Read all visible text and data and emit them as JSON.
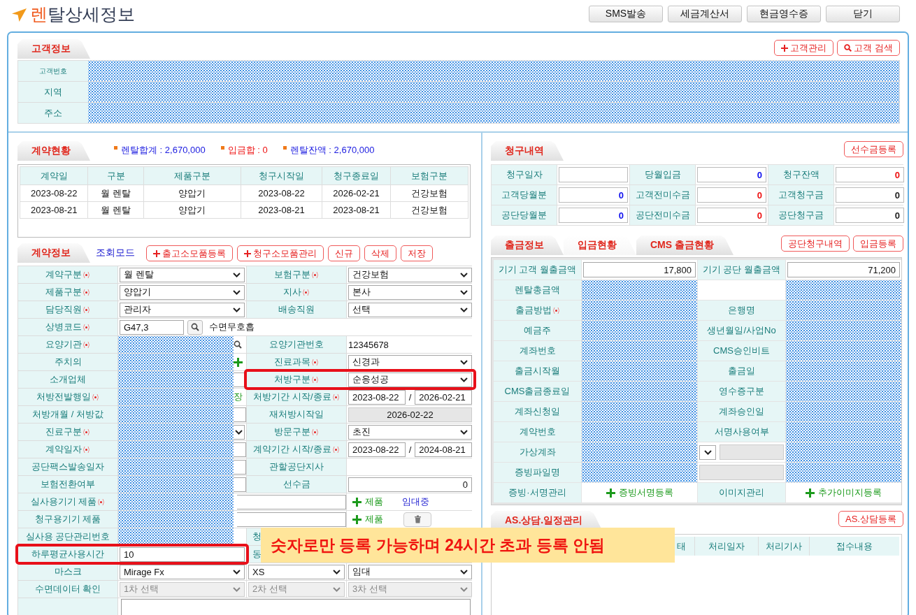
{
  "header": {
    "title_accent": "렌",
    "title": "탈상세정보",
    "buttons": [
      "SMS발송",
      "세금계산서",
      "현금영수증",
      "닫기"
    ]
  },
  "customer": {
    "tab": "고객정보",
    "buttons": [
      {
        "label": "고객관리",
        "kind": "add"
      },
      {
        "label": "고객 검색",
        "kind": "search"
      }
    ],
    "rows": [
      {
        "label": "고객번호",
        "kind": "small"
      },
      {
        "label": "지역",
        "kind": "normal"
      },
      {
        "label": "주소",
        "kind": "normal"
      }
    ]
  },
  "contract_status": {
    "tab": "계약현황",
    "summary": [
      {
        "text": "렌탈합계 : 2,670,000",
        "color": "#1a1ae0"
      },
      {
        "text": "입금합 : 0",
        "color": "#ee1111"
      },
      {
        "text": "렌탈잔액 : 2,670,000",
        "color": "#1a1ae0"
      }
    ],
    "table": {
      "columns": [
        "계약일",
        "구분",
        "제품구분",
        "청구시작일",
        "청구종료일",
        "보험구분"
      ],
      "rows": [
        [
          "2023-08-22",
          "월 렌탈",
          "양압기",
          "2023-08-22",
          "2026-02-21",
          "건강보험"
        ],
        [
          "2023-08-21",
          "월 렌탈",
          "양압기",
          "2023-08-21",
          "2023-08-21",
          "건강보험"
        ]
      ]
    }
  },
  "contract_info": {
    "tab": "계약정보",
    "mode": "조회모드",
    "buttons": [
      {
        "label": "출고소모품등록",
        "kind": "add"
      },
      {
        "label": "청구소모품관리",
        "kind": "add"
      },
      {
        "label": "신규",
        "kind": "plain"
      },
      {
        "label": "삭제",
        "kind": "plain"
      },
      {
        "label": "저장",
        "kind": "plain"
      }
    ],
    "rows": [
      {
        "kind": "pair",
        "label": "계약구분",
        "required": true,
        "value": {
          "kind": "select",
          "text": "월 렌탈"
        },
        "label2": "보험구분",
        "required2": true,
        "value2": {
          "kind": "select",
          "text": "건강보험"
        },
        "highlighted": false,
        "highlighted2": false
      },
      {
        "kind": "pair",
        "label": "제품구분",
        "required": true,
        "value": {
          "kind": "select",
          "text": "양압기"
        },
        "label2": "지사",
        "required2": true,
        "value2": {
          "kind": "select",
          "text": "본사"
        },
        "highlighted": false,
        "highlighted2": false
      },
      {
        "kind": "pair",
        "label": "담당직원",
        "required": true,
        "value": {
          "kind": "select",
          "text": "관리자"
        },
        "label2": "배송직원",
        "required2": false,
        "value2": {
          "kind": "select",
          "text": "선택"
        },
        "highlighted": false,
        "highlighted2": false
      },
      {
        "kind": "code",
        "label": "상병코드",
        "required": true,
        "value": {
          "kind": "input",
          "text": "G47,3"
        },
        "note": "수면무호흡",
        "highlighted": false
      },
      {
        "kind": "pair",
        "label": "요양기관",
        "required": true,
        "value": {
          "kind": "masked",
          "tail": {
            "kind": "search"
          }
        },
        "label2": "요양기관번호",
        "required2": false,
        "value2": {
          "kind": "text",
          "text": "12345678"
        },
        "highlighted": false,
        "highlighted2": false
      },
      {
        "kind": "pair",
        "label": "주치의",
        "required": false,
        "value": {
          "kind": "masked",
          "tail": {
            "kind": "plus"
          }
        },
        "label2": "진료과목",
        "required2": true,
        "value2": {
          "kind": "select",
          "text": "신경과"
        },
        "highlighted": false,
        "highlighted2": false
      },
      {
        "kind": "pair",
        "label": "소개업체",
        "required": false,
        "value": {
          "kind": "masked",
          "tail": {
            "kind": "edge"
          }
        },
        "label2": "처방구분",
        "required2": true,
        "value2": {
          "kind": "select",
          "text": "순응성공"
        },
        "highlighted": false,
        "highlighted2": true
      },
      {
        "kind": "pair",
        "label": "처방전발행일",
        "required": true,
        "value": {
          "kind": "masked",
          "tail": {
            "kind": "text",
            "text": "장"
          }
        },
        "label2": "처방기간 시작/종료",
        "required2": true,
        "value2": {
          "kind": "dates",
          "from": "2023-08-22",
          "sep": "/",
          "to": "2026-02-21"
        },
        "highlighted": false,
        "highlighted2": false
      },
      {
        "kind": "pair",
        "label": "처방개월 / 처방값",
        "required": false,
        "value": {
          "kind": "masked",
          "tail": {
            "kind": "edge"
          }
        },
        "label2": "재처방시작일",
        "required2": false,
        "value2": {
          "kind": "readonly",
          "text": "2026-02-22"
        },
        "highlighted": false,
        "highlighted2": false
      },
      {
        "kind": "pair",
        "label": "진료구분",
        "required": true,
        "value": {
          "kind": "masked",
          "tail": {
            "kind": "caret"
          }
        },
        "label2": "방문구분",
        "required2": true,
        "value2": {
          "kind": "select",
          "text": "초진"
        },
        "highlighted": false,
        "highlighted2": false
      },
      {
        "kind": "pair",
        "label": "계약일자",
        "required": true,
        "value": {
          "kind": "masked",
          "tail": {
            "kind": "edge"
          }
        },
        "label2": "계약기간 시작/종료",
        "required2": true,
        "value2": {
          "kind": "dates",
          "from": "2023-08-22",
          "sep": "/",
          "to": "2024-08-21"
        },
        "highlighted": false,
        "highlighted2": false
      },
      {
        "kind": "pair",
        "label": "공단팩스발송일자",
        "required": false,
        "value": {
          "kind": "masked",
          "tail": {
            "kind": "edge"
          }
        },
        "label2": "관할공단지사",
        "required2": false,
        "value2": {
          "kind": "empty"
        },
        "highlighted": false,
        "highlighted2": false
      },
      {
        "kind": "pair",
        "label": "보험전환여부",
        "required": false,
        "value": {
          "kind": "masked",
          "tail": {
            "kind": "edge"
          }
        },
        "label2": "선수금",
        "required2": false,
        "value2": {
          "kind": "number",
          "text": "0"
        },
        "highlighted": false,
        "highlighted2": false
      },
      {
        "kind": "product",
        "label": "실사용기기 제품",
        "required": true,
        "add": "제품",
        "extra": {
          "kind": "status",
          "text": "임대중"
        },
        "highlighted": false
      },
      {
        "kind": "product",
        "label": "청구용기기 제품",
        "required": false,
        "add": "제품",
        "extra": {
          "kind": "trash"
        },
        "highlighted": false
      },
      {
        "kind": "covered",
        "label": "실사용 공단관리번호",
        "required": false,
        "value": {
          "kind": "masked",
          "tail": {
            "kind": "none"
          }
        },
        "label2": "청",
        "highlighted": false
      },
      {
        "kind": "covered",
        "label": "하루평균사용시간",
        "required": false,
        "value": {
          "kind": "input",
          "text": "10"
        },
        "label2": "동",
        "highlighted": true
      },
      {
        "kind": "triple",
        "label": "마스크",
        "required": false,
        "values": [
          {
            "kind": "select",
            "text": "Mirage Fx",
            "disabled": false
          },
          {
            "kind": "select",
            "text": "XS",
            "disabled": false
          },
          {
            "kind": "select",
            "text": "임대",
            "disabled": false
          }
        ],
        "highlighted": false
      },
      {
        "kind": "triple",
        "label": "수면데이터 확인",
        "required": false,
        "values": [
          {
            "kind": "select",
            "text": "1차 선택",
            "disabled": true
          },
          {
            "kind": "select",
            "text": "2차 선택",
            "disabled": true
          },
          {
            "kind": "select",
            "text": "3차 선택",
            "disabled": true
          }
        ],
        "highlighted": false
      }
    ]
  },
  "billing": {
    "tab": "청구내역",
    "button": "선수금등록",
    "fields": [
      {
        "label": "청구일자"
      },
      {
        "label": "당월입금",
        "value": "0",
        "color": "#1010ee"
      },
      {
        "label": "청구잔액",
        "value": "0",
        "color": "#ee1010"
      },
      {
        "label": "고객당월분",
        "value": "0",
        "color": "#1010ee"
      },
      {
        "label": "고객전미수금",
        "value": "0",
        "color": "#ee1010"
      },
      {
        "label": "고객청구금",
        "value": "0",
        "color": "#222222"
      },
      {
        "label": "공단당월분",
        "value": "0",
        "color": "#1010ee"
      },
      {
        "label": "공단전미수금",
        "value": "0",
        "color": "#ee1010"
      },
      {
        "label": "공단청구금",
        "value": "0",
        "color": "#222222"
      }
    ]
  },
  "payment": {
    "tabs": [
      {
        "label": "출금정보",
        "selected": false
      },
      {
        "label": "입금현황",
        "selected": true
      },
      {
        "label": "CMS 출금현황",
        "selected": false
      }
    ],
    "buttons": [
      "공단청구내역",
      "입금등록"
    ],
    "rows": [
      {
        "label": "기기 고객 월출금액",
        "required": false,
        "value": {
          "kind": "number",
          "text": "17,800"
        },
        "label2": "기기 공단 월출금액",
        "value2": {
          "kind": "number",
          "text": "71,200"
        }
      },
      {
        "label": "렌탈총금액",
        "required": false,
        "value": {
          "kind": "masked"
        },
        "value2": {
          "kind": "masked"
        }
      },
      {
        "label": "출금방법",
        "required": true,
        "value": {
          "kind": "masked"
        },
        "label2": "은행명",
        "value2": {
          "kind": "masked"
        }
      },
      {
        "label": "예금주",
        "required": false,
        "value": {
          "kind": "masked"
        },
        "label2": "생년월일/사업No",
        "value2": {
          "kind": "masked"
        }
      },
      {
        "label": "계좌번호",
        "required": false,
        "value": {
          "kind": "masked"
        },
        "label2": "CMS승인비트",
        "value2": {
          "kind": "masked"
        }
      },
      {
        "label": "출금시작월",
        "required": false,
        "value": {
          "kind": "masked"
        },
        "label2": "출금일",
        "value2": {
          "kind": "masked"
        }
      },
      {
        "label": "CMS출금종료일",
        "required": false,
        "value": {
          "kind": "masked"
        },
        "label2": "영수증구분",
        "value2": {
          "kind": "masked"
        }
      },
      {
        "label": "계좌신청일",
        "required": false,
        "value": {
          "kind": "masked"
        },
        "label2": "계좌승인일",
        "value2": {
          "kind": "masked"
        }
      },
      {
        "label": "계약번호",
        "required": false,
        "value": {
          "kind": "masked"
        },
        "label2": "서명사용여부",
        "value2": {
          "kind": "masked"
        }
      },
      {
        "label": "가상계좌",
        "required": false,
        "value": {
          "kind": "masked"
        },
        "mid": {
          "kind": "select_input"
        },
        "value2": {
          "kind": "masked"
        }
      },
      {
        "label": "증빙파일명",
        "required": false,
        "value": {
          "kind": "masked"
        },
        "mid": {
          "kind": "gray_input"
        },
        "value2": {
          "kind": "masked"
        }
      },
      {
        "label": "증빙·서명관리",
        "required": false,
        "value": {
          "kind": "add_link",
          "text": "증빙서명등록"
        },
        "label2": "이미지관리",
        "value2": {
          "kind": "add_link",
          "text": "추가이미지등록"
        }
      }
    ]
  },
  "as": {
    "tab": "AS.상담.일정관리",
    "button": "AS.상담등록",
    "columns": [
      "태",
      "처리일자",
      "처리기사",
      "접수내용"
    ]
  },
  "callout": {
    "text": "숫자로만 등록 가능하며 24시간 초과 등록 안됨"
  }
}
